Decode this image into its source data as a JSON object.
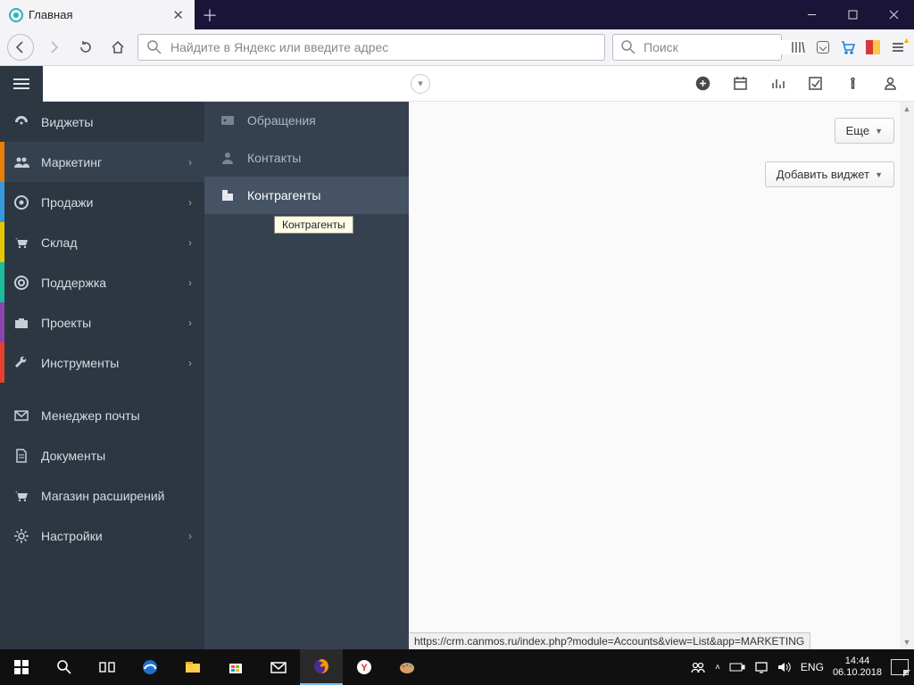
{
  "browser": {
    "tab_title": "Главная",
    "address_placeholder": "Найдите в Яндекс или введите адрес",
    "search_placeholder": "Поиск"
  },
  "sidebar1": {
    "items": [
      {
        "label": "Виджеты"
      },
      {
        "label": "Маркетинг"
      },
      {
        "label": "Продажи"
      },
      {
        "label": "Склад"
      },
      {
        "label": "Поддержка"
      },
      {
        "label": "Проекты"
      },
      {
        "label": "Инструменты"
      },
      {
        "label": "Менеджер почты"
      },
      {
        "label": "Документы"
      },
      {
        "label": "Магазин расширений"
      },
      {
        "label": "Настройки"
      }
    ],
    "accents": [
      "",
      "#e87e04",
      "#3598dc",
      "#e7c500",
      "#1bbc9b",
      "#8e44ad",
      "#e5412d",
      "",
      "",
      "",
      ""
    ]
  },
  "sidebar2": {
    "items": [
      {
        "label": "Обращения"
      },
      {
        "label": "Контакты"
      },
      {
        "label": "Контрагенты"
      }
    ],
    "tooltip": "Контрагенты"
  },
  "main": {
    "more_label": "Еще",
    "add_widget_label": "Добавить виджет"
  },
  "status_url": "https://crm.canmos.ru/index.php?module=Accounts&view=List&app=MARKETING",
  "taskbar": {
    "lang": "ENG",
    "time": "14:44",
    "date": "06.10.2018"
  }
}
